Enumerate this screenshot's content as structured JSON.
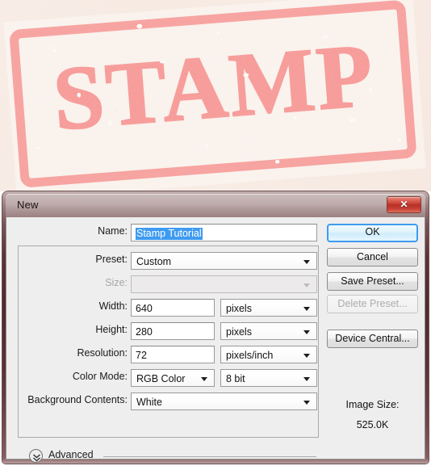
{
  "image": {
    "stamp_word": "STAMP",
    "ink_color": "#ef3b3b",
    "paper_color": "#fdf9f5"
  },
  "dialog": {
    "title": "New",
    "close_icon": "close-icon",
    "name_label": "Name:",
    "name_value": "Stamp Tutorial",
    "preset_label": "Preset:",
    "preset_value": "Custom",
    "size_label": "Size:",
    "size_value": "",
    "width_label": "Width:",
    "width_value": "640",
    "width_unit": "pixels",
    "height_label": "Height:",
    "height_value": "280",
    "height_unit": "pixels",
    "resolution_label": "Resolution:",
    "resolution_value": "72",
    "resolution_unit": "pixels/inch",
    "color_mode_label": "Color Mode:",
    "color_mode_value": "RGB Color",
    "color_depth_value": "8 bit",
    "background_contents_label": "Background Contents:",
    "background_contents_value": "White",
    "advanced_label": "Advanced",
    "advanced_icon": "chevron-double-down-icon",
    "buttons": {
      "ok": "OK",
      "cancel": "Cancel",
      "save_preset": "Save Preset...",
      "delete_preset": "Delete Preset...",
      "device_central": "Device Central..."
    },
    "image_size_title": "Image Size:",
    "image_size_value": "525.0K",
    "accent_color": "#3e9bf0",
    "titlebar_color": "#c0aeae",
    "frame_color": "#52292d"
  }
}
